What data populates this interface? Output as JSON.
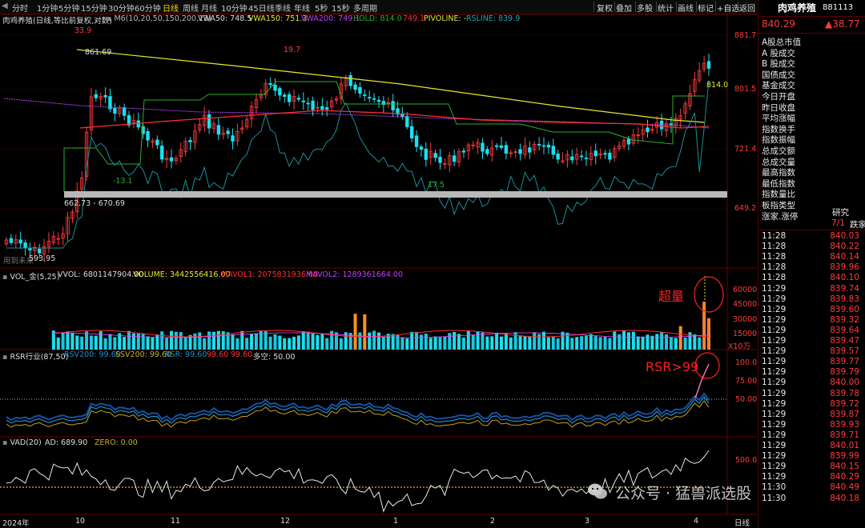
{
  "toolbar": {
    "period_tabs": [
      "分时",
      "1分钟",
      "5分钟",
      "15分钟",
      "30分钟",
      "60分钟",
      "日线",
      "周线",
      "月线",
      "10分钟",
      "45日线",
      "季线",
      "年线",
      "5秒",
      "15秒",
      "多周期"
    ],
    "active_tab": "日线",
    "right_buttons": [
      "复权",
      "叠加",
      "多股",
      "统计",
      "画线",
      "标记",
      "+自选",
      "返回"
    ]
  },
  "main_legend": {
    "name": "肉鸡养殖(日线,等比前复权,对数)",
    "m6": "M6(10,20,50,150,200,13)",
    "vwa50": "VWA50: 748.5",
    "vwa150": "VWA150: 751.3",
    "vwa200": "VWA200: 749.1",
    "hold": "HOLD: 814.0",
    "hold_val": "749.1",
    "pivoline": "PIVOLINE: -",
    "rsline": "RSLINE: 839.9"
  },
  "main_axis": {
    "top": "881.7",
    "t2": "801.5",
    "t3": "721.4",
    "t4": "649.2"
  },
  "annotations": {
    "hi1": "33.9",
    "hi2": "19.7",
    "peak": "861.69",
    "low1": "-13.1",
    "low2": "17.5",
    "band": "662.73 - 670.69",
    "low_price": "593.95",
    "new_low_note": "用到未来",
    "last_price_tag": "814.0"
  },
  "vol_legend": {
    "name": "VOL_金(5,25)",
    "vvol": "VVOL: 6801147904.00",
    "volume": "VOLUME: 3442556416.00",
    "mavol1": "MAVOL1: 2075831936.00",
    "mavol2": "MAVOL2: 1289361664.00",
    "axis": [
      "60000",
      "45000",
      "30000",
      "15000"
    ],
    "unit": "X10万",
    "callout": "超量"
  },
  "rsr_legend": {
    "name": "RSR行业(87,50)",
    "rsv200": "RSV200: 99.60",
    "ssv200": "SSV200: 99.60",
    "rsr": "RSR: 99.60",
    "v1": "99.60",
    "v2": "99.60",
    "dk": "多空: 50.00",
    "axis": [
      "100.0",
      "75.00",
      "50.00"
    ],
    "callout": "RSR>99"
  },
  "vad_legend": {
    "name": "VAD(20)",
    "ad": "AD: 689.90",
    "zero": "ZERO: 0.00",
    "axis": [
      "500.0"
    ]
  },
  "x_axis": {
    "labels": [
      "2024年",
      "10",
      "11",
      "12",
      "1",
      "2",
      "3",
      "4"
    ],
    "period": "日线"
  },
  "right_panel": {
    "title": "肉鸡养殖",
    "code": "881113",
    "price": "840.29",
    "change": "▲38.77",
    "fields": [
      "A股总市值",
      "A 股成交",
      "B 股成交",
      "国债成交",
      "基金成交",
      "今日开盘",
      "昨日收盘",
      "平均涨幅",
      "指数换手",
      "指数振幅",
      "总成交额",
      "总成交量",
      "最高指数",
      "最低指数",
      "指数量比",
      "板指类型",
      "涨家.涨停"
    ],
    "type_val": "研究",
    "updown_val": "7/1",
    "updown_tail": "跌家",
    "ticks": [
      [
        "11:28",
        "840.03"
      ],
      [
        "11:28",
        "840.22"
      ],
      [
        "11:28",
        "840.14"
      ],
      [
        "11:28",
        "839.96"
      ],
      [
        "11:28",
        "840.10"
      ],
      [
        "11:29",
        "839.74"
      ],
      [
        "11:29",
        "839.83"
      ],
      [
        "11:29",
        "839.60"
      ],
      [
        "11:29",
        "839.32"
      ],
      [
        "11:29",
        "839.64"
      ],
      [
        "11:29",
        "839.47"
      ],
      [
        "11:29",
        "839.57"
      ],
      [
        "11:29",
        "839.77"
      ],
      [
        "11:29",
        "839.79"
      ],
      [
        "11:29",
        "840.00"
      ],
      [
        "11:29",
        "839.78"
      ],
      [
        "11:29",
        "839.72"
      ],
      [
        "11:29",
        "839.87"
      ],
      [
        "11:29",
        "839.93"
      ],
      [
        "11:29",
        "839.71"
      ],
      [
        "11:29",
        "840.01"
      ],
      [
        "11:29",
        "839.99"
      ],
      [
        "11:29",
        "840.15"
      ],
      [
        "11:29",
        "840.29"
      ],
      [
        "11:30",
        "840.49"
      ],
      [
        "11:30",
        "840.18"
      ]
    ]
  },
  "watermark": "公众号 · 猛兽派选股",
  "colors": {
    "up": "#ff3b3b",
    "down": "#19e0f0",
    "ma_yellow": "#e8e830",
    "ma_purple": "#c040ff",
    "ma_green": "#2bb02b",
    "ma_red": "#ff3030",
    "rs_line": "#1a8f98",
    "grid": "#5a0000"
  }
}
